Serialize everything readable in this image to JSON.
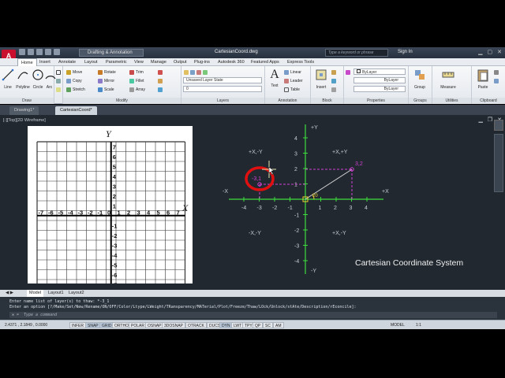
{
  "app": {
    "logo": "A",
    "workspace": "Drafting & Annotation",
    "window_title": "CartesianCoord.dwg",
    "search_placeholder": "Type a keyword or phrase",
    "sign_in": "Sign In"
  },
  "ribbon_tabs": [
    "Home",
    "Insert",
    "Annotate",
    "Layout",
    "Parametric",
    "View",
    "Manage",
    "Output",
    "Plug-ins",
    "Autodesk 360",
    "Featured Apps",
    "Express Tools"
  ],
  "ribbon": {
    "draw": {
      "label": "Draw",
      "line": "Line",
      "polyline": "Polyline",
      "circle": "Circle",
      "arc": "Arc"
    },
    "modify": {
      "label": "Modify",
      "move": "Move",
      "rotate": "Rotate",
      "trim": "Trim",
      "copy": "Copy",
      "mirror": "Mirror",
      "fillet": "Fillet",
      "stretch": "Stretch",
      "scale": "Scale",
      "array": "Array"
    },
    "layers": {
      "label": "Layers",
      "state": "Unsaved Layer State",
      "current": "0"
    },
    "annotation": {
      "label": "Annotation",
      "text": "Text",
      "linear": "Linear",
      "leader": "Leader",
      "table": "Table"
    },
    "block": {
      "label": "Block",
      "insert": "Insert"
    },
    "properties": {
      "label": "Properties",
      "color": "ByLayer",
      "linetype": "ByLayer",
      "lineweight": "ByLayer"
    },
    "groups": {
      "label": "Groups",
      "group": "Group"
    },
    "utilities": {
      "label": "Utilities",
      "measure": "Measure"
    },
    "clipboard": {
      "label": "Clipboard",
      "paste": "Paste"
    }
  },
  "doc_tabs": [
    "Drawing1*",
    "CartesianCoord*"
  ],
  "viewport": {
    "label": "[-][Top][2D Wireframe]",
    "caption": "Cartesian Coordinate System",
    "axis": {
      "plus_y": "+Y",
      "minus_y": "-Y",
      "plus_x": "+X",
      "minus_x": "-X",
      "x_ticks": [
        "-4",
        "-3",
        "-2",
        "-1",
        "1",
        "2",
        "3",
        "4"
      ],
      "y_ticks": [
        "4",
        "3",
        "2",
        "1",
        "-1",
        "-2",
        "-3",
        "-4"
      ],
      "quadrants": [
        "+X,+Y",
        "+X,-Y",
        "-X,-Y",
        "+X,-Y"
      ],
      "point_a": "3,2",
      "point_b": "-3,1",
      "angle_label": "20"
    },
    "paper": {
      "y_label": "Y",
      "x_label": "X",
      "x_ticks": [
        "-7",
        "-6",
        "-5",
        "-4",
        "-3",
        "-2",
        "-1",
        "0",
        "1",
        "2",
        "3",
        "4",
        "5",
        "6",
        "7"
      ],
      "y_ticks_pos": [
        "7",
        "6",
        "5",
        "4",
        "3",
        "2",
        "1"
      ],
      "y_ticks_neg": [
        "-1",
        "-2",
        "-3",
        "-4",
        "-5",
        "-6",
        "-7"
      ]
    }
  },
  "layout_tabs": [
    "Model",
    "Layout1",
    "Layout2"
  ],
  "command": {
    "history_1": "Enter name list of layer(s) to thaw: *-3_1",
    "history_2": "Enter an option [?/Make/Set/New/Rename/ON/OFF/Color/Ltype/LWeight/TRansparency/MATerial/Plot/Freeze/Thaw/LOck/Unlock/stAte/Description/rEconcile]:",
    "input_placeholder": "Type a command"
  },
  "status": {
    "coords": "2.4371 , 2.1849 , 0.0000",
    "buttons": [
      "INFER",
      "SNAP",
      "GRID",
      "ORTHO",
      "POLAR",
      "OSNAP",
      "3DOSNAP",
      "OTRACK",
      "DUCS",
      "DYN",
      "LWT",
      "TPY",
      "QP",
      "SC",
      "AM"
    ],
    "model": "MODEL",
    "scale": "1:1"
  },
  "colors": {
    "axis_green": "#3ddc3d",
    "magenta": "#d040d0",
    "red_highlight": "#e01010",
    "viewport_bg": "#212830"
  }
}
